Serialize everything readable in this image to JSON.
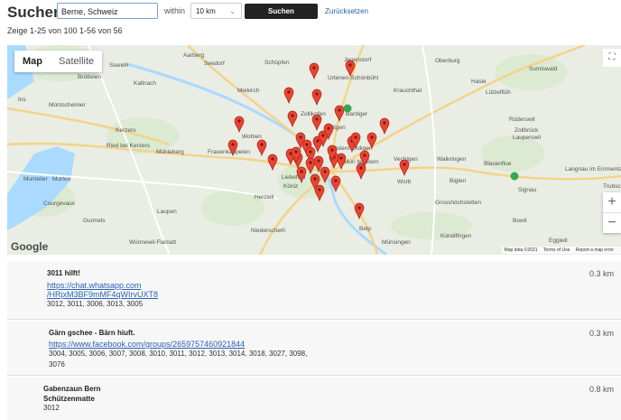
{
  "header": {
    "title": "Suchen",
    "search_value": "Berne, Schweiz",
    "within_label": "within",
    "radius_value": "10 km",
    "search_button": "Suchen",
    "reset_link": "Zurücksetzen"
  },
  "result_count": "Zeige 1-25 von 100 1-56 von 56",
  "map": {
    "tabs": [
      "Map",
      "Satellite"
    ],
    "zoom_in": "+",
    "zoom_out": "−",
    "logo": "Google",
    "attribution": [
      "Map data ©2021",
      "Terms of Use",
      "Report a map error"
    ],
    "place_labels": [
      "Aarberg",
      "Seedorf",
      "Schüpfen",
      "Jegenstorf",
      "Oberburg",
      "Sumiswald",
      "Siselen",
      "Brüttelen",
      "Kallnach",
      "Urtenen-Schönbühl",
      "Krauchthal",
      "Hasle",
      "Lützelflüh",
      "Ins",
      "Müntschemier",
      "Meikirch",
      "Zollikofen",
      "Bantiger",
      "Kerzers",
      "Ittigen",
      "Rüderswil",
      "Zollbrück",
      "Lauperswil",
      "Ried bei Kerzers",
      "Mühleberg",
      "Frauenkappelen",
      "Wohlen",
      "Ostermundigen",
      "Murten",
      "Muntelier",
      "Muri bei Bern",
      "Worb",
      "Walkringen",
      "Langnau im Emmental",
      "Trubschachen",
      "Courgevaux",
      "Herzwil",
      "Liebefeld",
      "Köniz",
      "Vechigen",
      "Biglen",
      "Blasenflue",
      "Signau",
      "Grosshöchstetten",
      "Laupen",
      "Gurmels",
      "Niederscherli",
      "Bowil",
      "Wünnewil-Flamatt",
      "Belp",
      "Münsingen",
      "Konolfingen",
      "Eggiwil"
    ]
  },
  "results": [
    {
      "name": "3011 hilft!",
      "link_lines": [
        "https://chat.whatsapp.com",
        "/HRjxM3BF9mMF4qWIrvUXT8"
      ],
      "zip_lines": [
        "3012, 3011, 3006, 3013, 3005"
      ],
      "distance": "0.3 km"
    },
    {
      "name": "Gärn gschee - Bärn hiuft.",
      "link_lines": [
        "https://www.facebook.com/groups/2659757460921844"
      ],
      "zip_lines": [
        "3004, 3005, 3006, 3007, 3008, 3010, 3011, 3012, 3013, 3014, 3018, 3027, 3098,",
        "3076"
      ],
      "distance": "0.3 km"
    },
    {
      "name_lines": [
        "Gabenzaun Bern",
        "Schützenmatte"
      ],
      "zip_lines": [
        "3012"
      ],
      "distance": "0.8 km"
    }
  ]
}
